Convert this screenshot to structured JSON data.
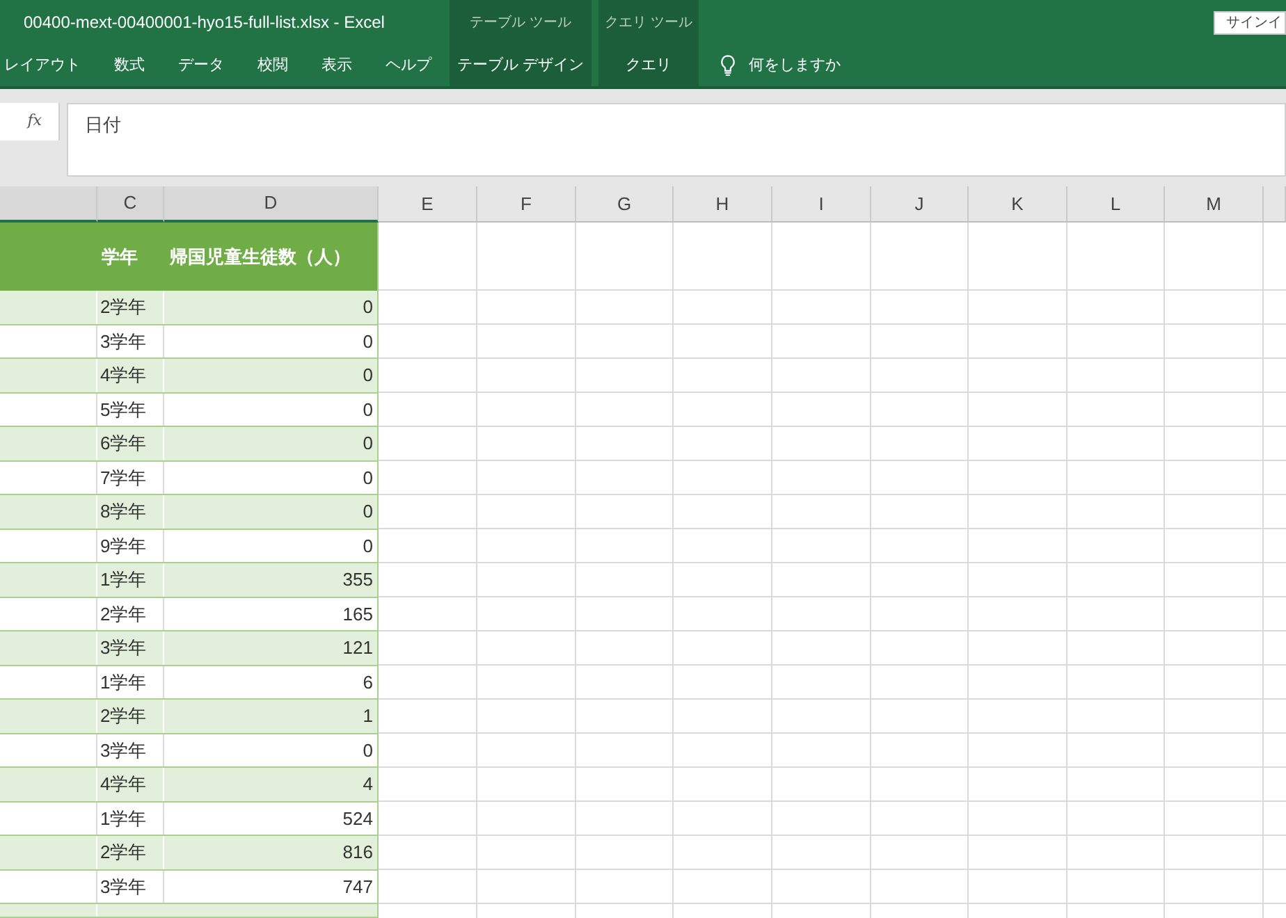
{
  "window": {
    "title": "00400-mext-00400001-hyo15-full-list.xlsx - Excel"
  },
  "account": {
    "sign_in": "サインイ"
  },
  "ribbon": {
    "tabs": [
      {
        "label": "レイアウト"
      },
      {
        "label": "数式"
      },
      {
        "label": "データ"
      },
      {
        "label": "校閲"
      },
      {
        "label": "表示"
      },
      {
        "label": "ヘルプ"
      }
    ],
    "context_groups": [
      {
        "label": "テーブル ツール",
        "tabs": [
          {
            "label": "テーブル デザイン"
          }
        ]
      },
      {
        "label": "クエリ ツール",
        "tabs": [
          {
            "label": "クエリ"
          }
        ]
      }
    ],
    "tell_me": {
      "placeholder": "何をしますか"
    }
  },
  "formula_bar": {
    "function_button": "fx",
    "value": "日付"
  },
  "sheet": {
    "columns": [
      {
        "selected": true
      },
      {
        "letter": "C",
        "selected": true
      },
      {
        "letter": "D",
        "selected": true
      },
      {
        "letter": "E",
        "selected": false
      },
      {
        "letter": "F",
        "selected": false
      },
      {
        "letter": "G",
        "selected": false
      },
      {
        "letter": "H",
        "selected": false
      },
      {
        "letter": "I",
        "selected": false
      },
      {
        "letter": "J",
        "selected": false
      },
      {
        "letter": "K",
        "selected": false
      },
      {
        "letter": "L",
        "selected": false
      },
      {
        "letter": "M",
        "selected": false
      },
      {
        "selected": false
      }
    ]
  },
  "table": {
    "columns": [
      "学年",
      "帰国児童生徒数（人）"
    ],
    "rows": [
      {
        "grade": "2学年",
        "count": "0"
      },
      {
        "grade": "3学年",
        "count": "0"
      },
      {
        "grade": "4学年",
        "count": "0"
      },
      {
        "grade": "5学年",
        "count": "0"
      },
      {
        "grade": "6学年",
        "count": "0"
      },
      {
        "grade": "7学年",
        "count": "0"
      },
      {
        "grade": "8学年",
        "count": "0"
      },
      {
        "grade": "9学年",
        "count": "0"
      },
      {
        "grade": "1学年",
        "count": "355"
      },
      {
        "grade": "2学年",
        "count": "165"
      },
      {
        "grade": "3学年",
        "count": "121"
      },
      {
        "grade": "1学年",
        "count": "6"
      },
      {
        "grade": "2学年",
        "count": "1"
      },
      {
        "grade": "3学年",
        "count": "0"
      },
      {
        "grade": "4学年",
        "count": "4"
      },
      {
        "grade": "1学年",
        "count": "524"
      },
      {
        "grade": "2学年",
        "count": "816"
      },
      {
        "grade": "3学年",
        "count": "747"
      }
    ]
  }
}
